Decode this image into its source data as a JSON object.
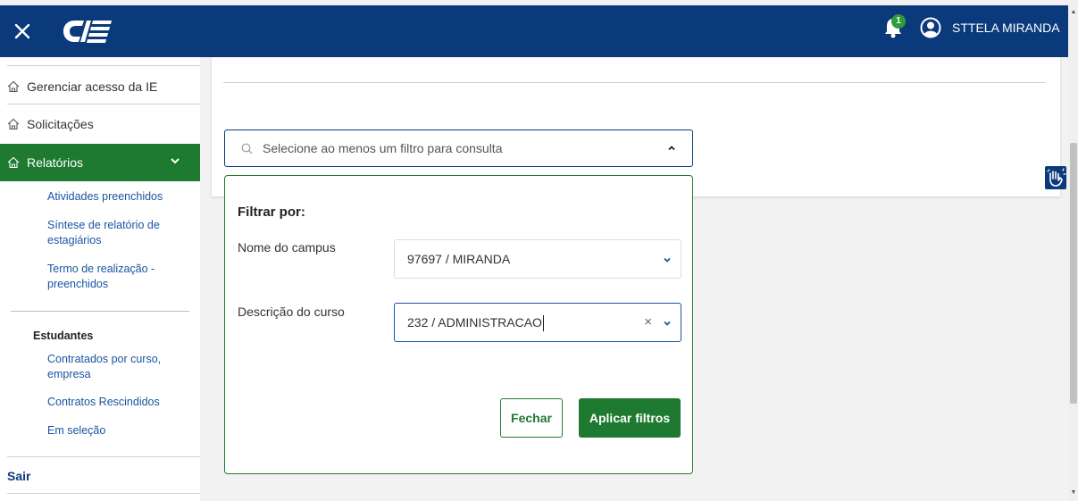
{
  "header": {
    "user_name": "STTELA MIRANDA",
    "notification_count": "1",
    "brand_color": "#0a3a7c"
  },
  "sidebar": {
    "items": [
      {
        "label": "Gerenciar acesso da IE",
        "icon": "home-icon"
      },
      {
        "label": "Solicitações",
        "icon": "home-icon"
      },
      {
        "label": "Relatórios",
        "icon": "home-icon",
        "active": true
      }
    ],
    "relatorios_sub": [
      "Atividades preenchidos",
      "Síntese de relatório de estagiários",
      "Termo de realização - preenchidos"
    ],
    "estudantes_heading": "Estudantes",
    "estudantes_sub": [
      "Contratados por curso, empresa",
      "Contratos Rescindidos",
      "Em seleção"
    ],
    "logout_label": "Sair",
    "active_color": "#1e7a30"
  },
  "filter": {
    "search_placeholder": "Selecione ao menos um filtro para consulta",
    "panel_title": "Filtrar por:",
    "campus_label": "Nome do campus",
    "campus_value": "97697 / MIRANDA",
    "curso_label": "Descrição do curso",
    "curso_value": "232 / ADMINISTRACAO",
    "close_label": "Fechar",
    "apply_label": "Aplicar filtros"
  }
}
